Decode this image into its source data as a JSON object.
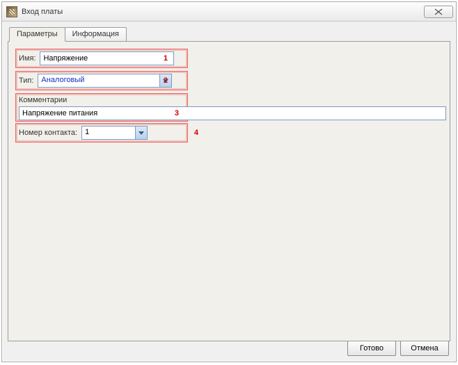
{
  "window": {
    "title": "Вход платы"
  },
  "tabs": {
    "parameters": "Параметры",
    "info": "Информация",
    "activeIndex": 0
  },
  "fields": {
    "name": {
      "label": "Имя:",
      "value": "Напряжение"
    },
    "type": {
      "label": "Тип:",
      "value": "Аналоговый"
    },
    "comments": {
      "label": "Комментарии",
      "value": "Напряжение питания"
    },
    "contact": {
      "label": "Номер контакта:",
      "value": "1"
    }
  },
  "markers": {
    "m1": "1",
    "m2": "2",
    "m3": "3",
    "m4": "4"
  },
  "buttons": {
    "ok": "Готово",
    "cancel": "Отмена"
  }
}
